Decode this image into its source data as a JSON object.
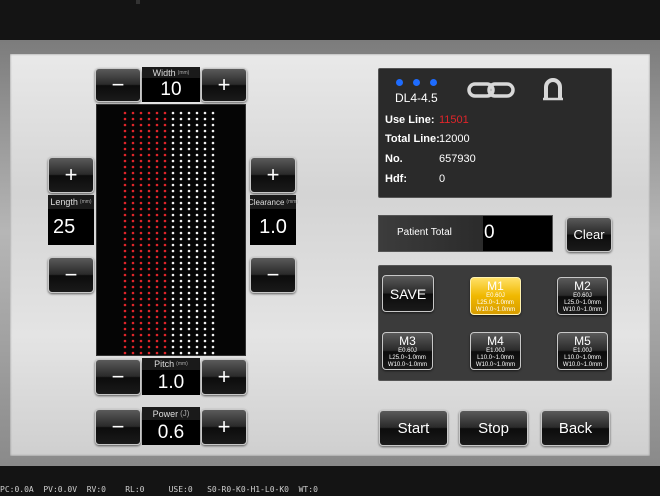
{
  "colors": {
    "accent_red": "#e0252a",
    "active_mem": "#f0b800",
    "dot_blue": "#1e6cff"
  },
  "width": {
    "label": "Width",
    "unit": "(mm)",
    "value": "10",
    "minus": "−",
    "plus": "+"
  },
  "length": {
    "label": "Length",
    "unit": "(mm)",
    "value": "25",
    "minus": "−",
    "plus": "+"
  },
  "clearance": {
    "label": "Clearance",
    "unit": "(mm)",
    "value": "1.0",
    "minus": "−",
    "plus": "+"
  },
  "pitch": {
    "label": "Pitch",
    "unit": "(mm)",
    "value": "1.0",
    "minus": "−",
    "plus": "+"
  },
  "power": {
    "label": "Power",
    "unit": "(J)",
    "value": "0.6",
    "minus": "−",
    "plus": "+"
  },
  "preview": {
    "red_columns": 6,
    "white_columns": 6,
    "rows": 41
  },
  "info": {
    "model": "DL4-4.5",
    "icons": [
      "link-icon",
      "magnet-icon"
    ],
    "rows": [
      {
        "label": "Use Line:",
        "value": "11501",
        "highlight": true
      },
      {
        "label": "Total Line:",
        "value": "12000"
      },
      {
        "label": "No.",
        "value": "657930"
      },
      {
        "label": "Hdf:",
        "value": "0"
      }
    ]
  },
  "patient_total": {
    "label": "Patient Total",
    "value": "0",
    "clear_label": "Clear"
  },
  "memory": {
    "save_label": "SAVE",
    "slots": [
      {
        "name": "M1",
        "line1": "E0.60J",
        "line2": "L25.0~1.0mm",
        "line3": "W10.0~1.0mm",
        "active": true
      },
      {
        "name": "M2",
        "line1": "E0.60J",
        "line2": "L25.0~1.0mm",
        "line3": "W10.0~1.0mm"
      },
      {
        "name": "M3",
        "line1": "E0.60J",
        "line2": "L25.0~1.0mm",
        "line3": "W10.0~1.0mm"
      },
      {
        "name": "M4",
        "line1": "E1.00J",
        "line2": "L10.0~1.0mm",
        "line3": "W10.0~1.0mm"
      },
      {
        "name": "M5",
        "line1": "E1.00J",
        "line2": "L10.0~1.0mm",
        "line3": "W10.0~1.0mm"
      }
    ]
  },
  "actions": {
    "start": "Start",
    "stop": "Stop",
    "back": "Back"
  },
  "status_line": "PC:0.0A  PV:0.0V  RV:0    RL:0     USE:0   S0-R0-K0-H1-L0-K0  WT:0"
}
